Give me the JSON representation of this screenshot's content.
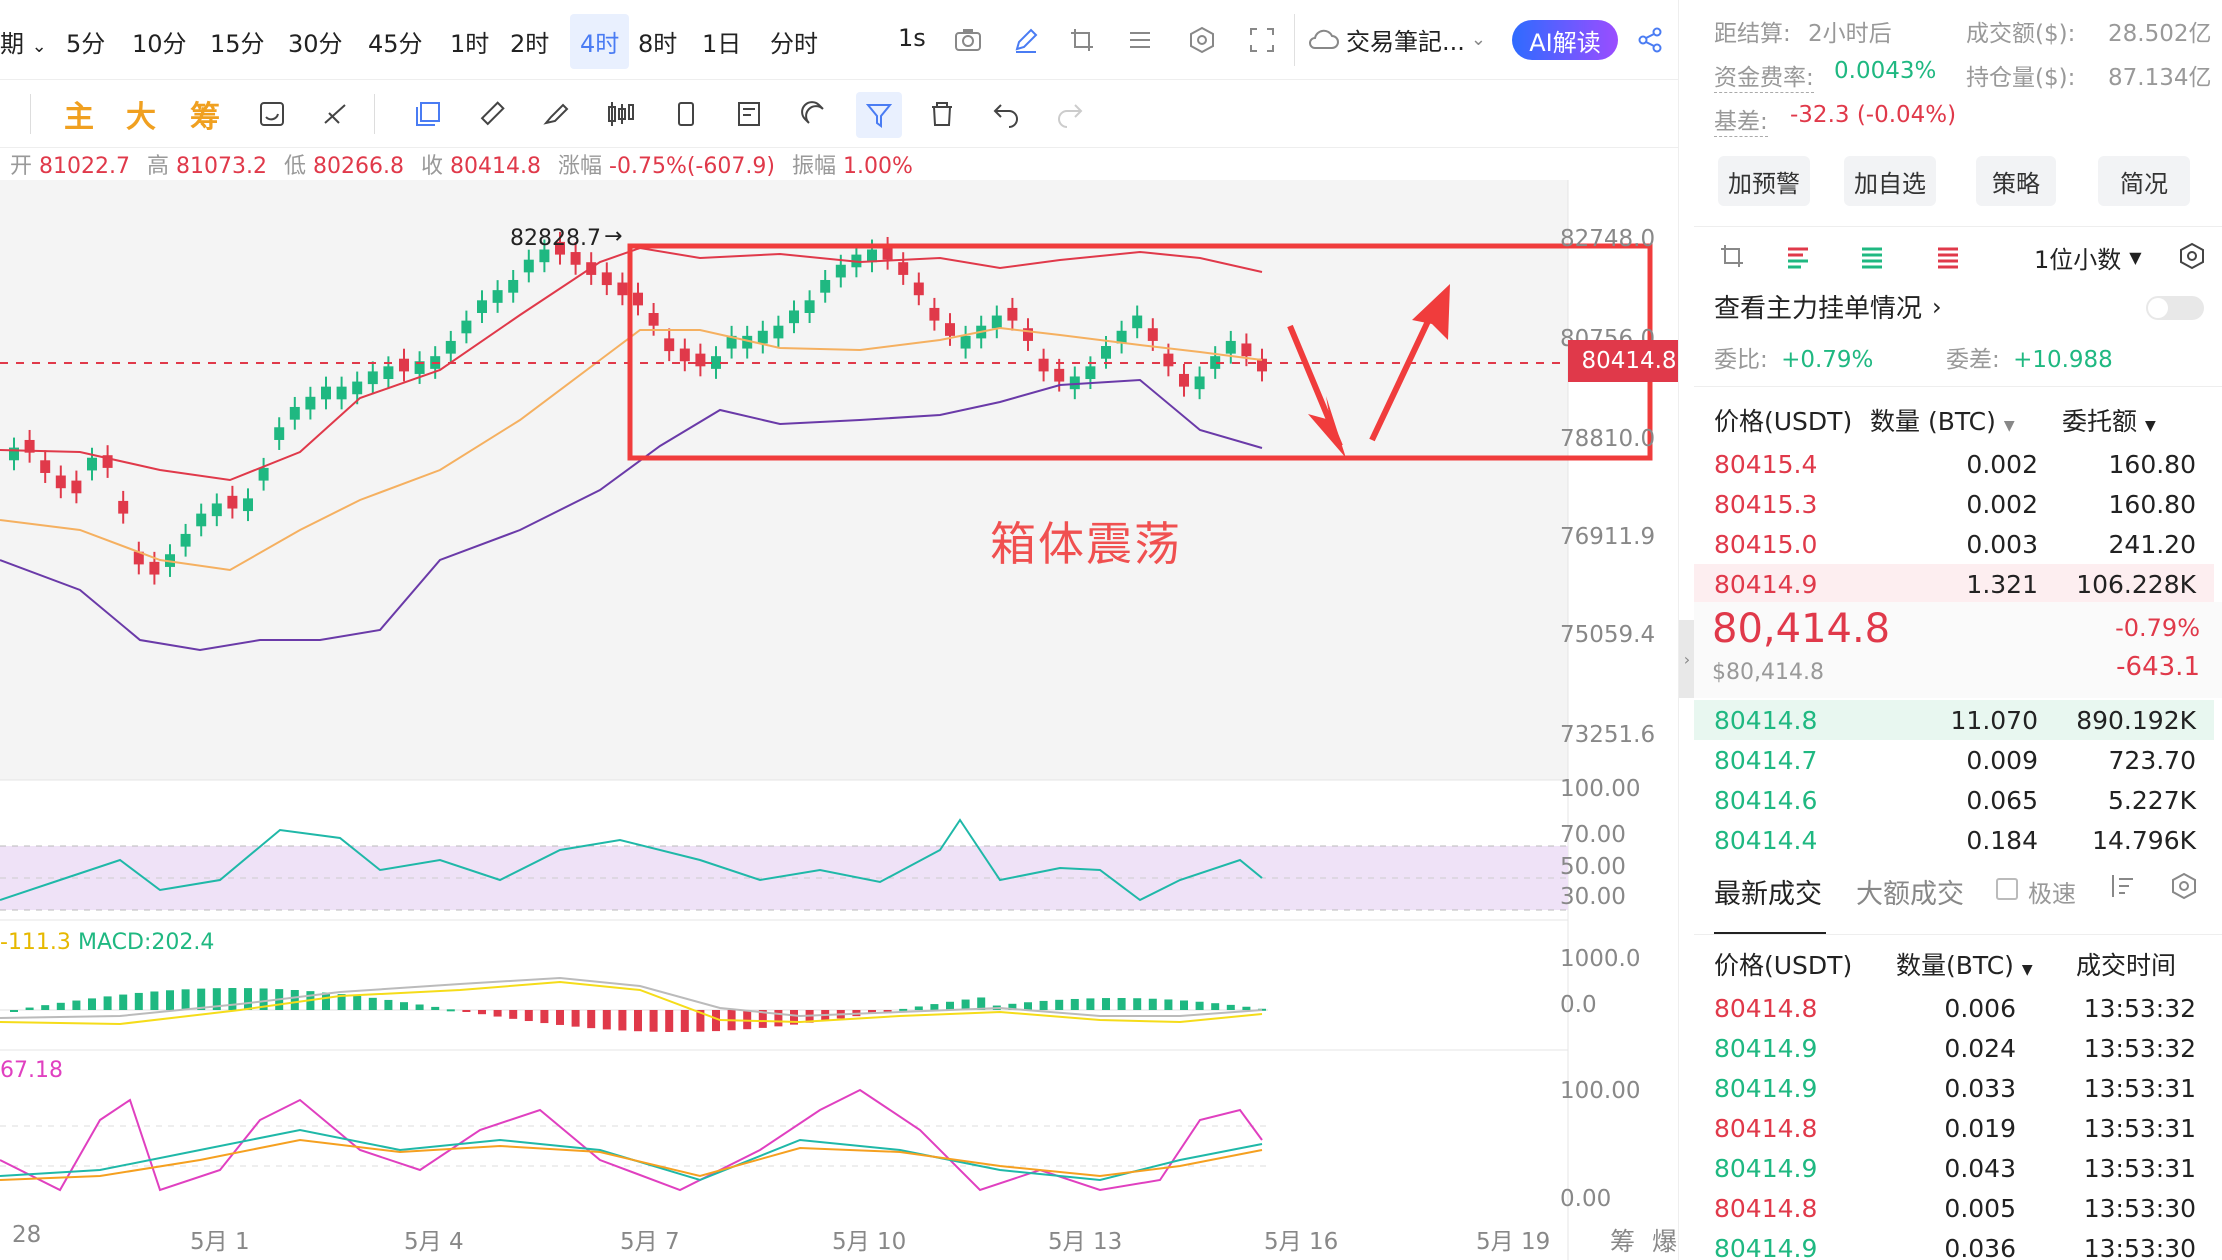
{
  "toolbar": {
    "period_cut": "期",
    "timeframes": [
      "5分",
      "10分",
      "15分",
      "30分",
      "45分",
      "1时",
      "2时",
      "4时",
      "8时",
      "1日",
      "分时"
    ],
    "active_timeframe": "4时",
    "interval_1s": "1s",
    "notes_label": "交易筆記...",
    "ai_label": "AI解读"
  },
  "indicator_row": {
    "main": "主",
    "big": "大",
    "chip": "筹"
  },
  "ohlc": {
    "open_label": "开",
    "open": "81022.7",
    "high_label": "高",
    "high": "81073.2",
    "low_label": "低",
    "low": "80266.8",
    "close_label": "收",
    "close": "80414.8",
    "change_label": "涨幅",
    "change": "-0.75%(-607.9)",
    "amp_label": "振幅",
    "amp": "1.00%"
  },
  "chart": {
    "peak_label": "82828.7",
    "current_price_tag": "80414.8",
    "annotation": "箱体震荡",
    "y_axis": [
      "82748.0",
      "80756.0",
      "78810.0",
      "76911.9",
      "75059.4",
      "73251.6"
    ],
    "rsi_axis": [
      "100.00",
      "70.00",
      "50.00",
      "30.00"
    ],
    "macd_label_left": "-111.3",
    "macd_label": "MACD:202.4",
    "macd_axis": [
      "1000.0",
      "0.0"
    ],
    "kdj_label_left": "67.18",
    "kdj_axis": [
      "100.00",
      "0.00"
    ],
    "x_axis": [
      "28",
      "5月 1",
      "5月 4",
      "5月 7",
      "5月 10",
      "5月 13",
      "5月 16",
      "5月 19"
    ],
    "bottom_icons": [
      "筹",
      "爆"
    ],
    "colors": {
      "up": "#1fb881",
      "down": "#e0394a",
      "box": "#f03c3c",
      "accent": "#4a7cf3"
    }
  },
  "right": {
    "settle_label": "距结算:",
    "settle_value": "2小时后",
    "volume_label": "成交额($):",
    "volume_value": "28.502亿",
    "funding_label": "资金费率:",
    "funding_value": "0.0043%",
    "oi_label": "持仓量($):",
    "oi_value": "87.134亿",
    "basis_label": "基差:",
    "basis_value": "-32.3 (-0.04%)",
    "buttons": [
      "加预警",
      "加自选",
      "策略",
      "简况"
    ],
    "precision": "1位小数",
    "view_main_orders": "查看主力挂单情况",
    "wei_bi_label": "委比:",
    "wei_bi": "+0.79%",
    "wei_cha_label": "委差:",
    "wei_cha": "+10.988",
    "ob_headers": [
      "价格(USDT)",
      "数量 (BTC)",
      "委托额"
    ],
    "asks": [
      {
        "p": "80415.4",
        "q": "0.002",
        "a": "160.80"
      },
      {
        "p": "80415.3",
        "q": "0.002",
        "a": "160.80"
      },
      {
        "p": "80415.0",
        "q": "0.003",
        "a": "241.20"
      },
      {
        "p": "80414.9",
        "q": "1.321",
        "a": "106.228K"
      }
    ],
    "last_price": "80,414.8",
    "last_usd": "$80,414.8",
    "last_pct": "-0.79%",
    "last_chg": "-643.1",
    "bids": [
      {
        "p": "80414.8",
        "q": "11.070",
        "a": "890.192K"
      },
      {
        "p": "80414.7",
        "q": "0.009",
        "a": "723.70"
      },
      {
        "p": "80414.6",
        "q": "0.065",
        "a": "5.227K"
      },
      {
        "p": "80414.4",
        "q": "0.184",
        "a": "14.796K"
      }
    ],
    "trade_tabs": [
      "最新成交",
      "大额成交"
    ],
    "fast_label": "极速",
    "trade_headers": [
      "价格(USDT)",
      "数量(BTC)",
      "成交时间"
    ],
    "trades": [
      {
        "p": "80414.8",
        "q": "0.006",
        "t": "13:53:32",
        "side": "down"
      },
      {
        "p": "80414.9",
        "q": "0.024",
        "t": "13:53:32",
        "side": "up"
      },
      {
        "p": "80414.9",
        "q": "0.033",
        "t": "13:53:31",
        "side": "up"
      },
      {
        "p": "80414.8",
        "q": "0.019",
        "t": "13:53:31",
        "side": "down"
      },
      {
        "p": "80414.9",
        "q": "0.043",
        "t": "13:53:31",
        "side": "up"
      },
      {
        "p": "80414.8",
        "q": "0.005",
        "t": "13:53:30",
        "side": "down"
      },
      {
        "p": "80414.9",
        "q": "0.036",
        "t": "13:53:30",
        "side": "up"
      }
    ]
  }
}
